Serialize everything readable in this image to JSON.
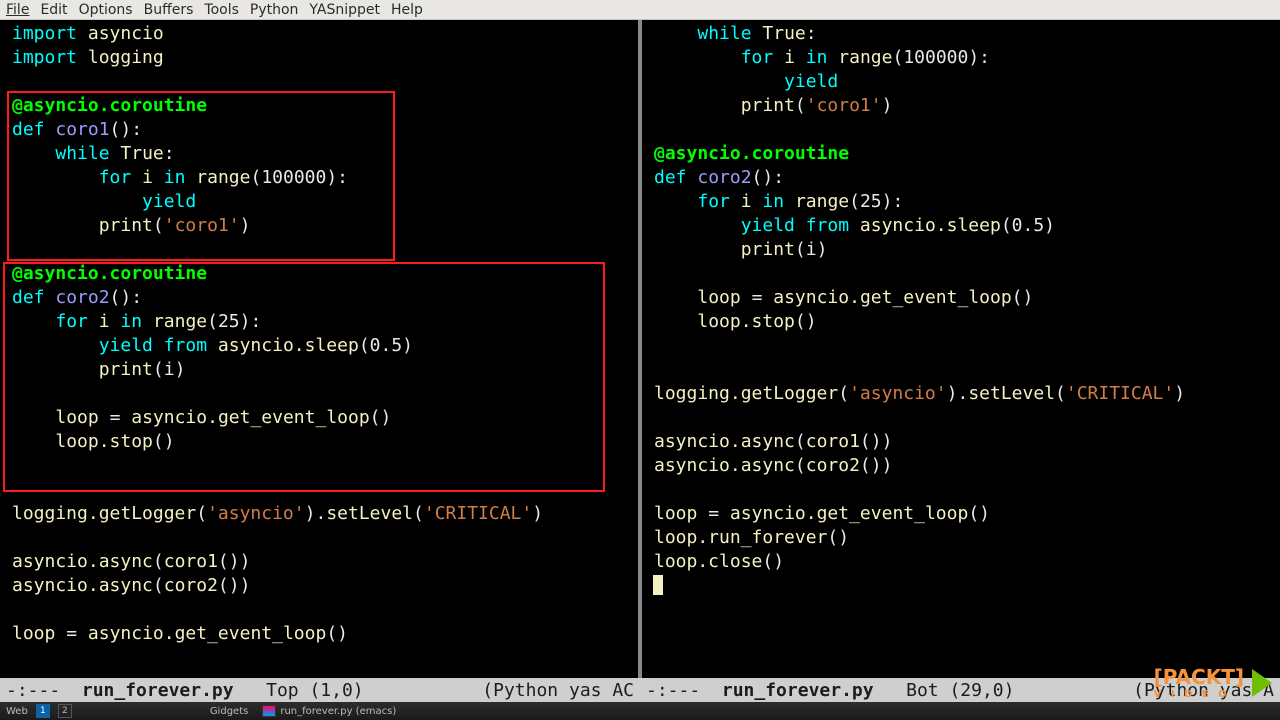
{
  "menubar": [
    "File",
    "Edit",
    "Options",
    "Buffers",
    "Tools",
    "Python",
    "YASnippet",
    "Help"
  ],
  "left": {
    "code_html": "<span class='kw'>import</span> <span class='id'>asyncio</span>\n<span class='kw'>import</span> <span class='id'>logging</span>\n\n<span class='dec'>@asyncio.coroutine</span>\n<span class='kw'>def</span> <span class='fn'>coro1</span><span class='pn'>():</span>\n    <span class='kw'>while</span> <span class='id'>True</span><span class='pn'>:</span>\n        <span class='kw'>for</span> <span class='id'>i</span> <span class='kw'>in</span> <span class='id'>range</span><span class='pn'>(</span><span class='num'>100000</span><span class='pn'>):</span>\n            <span class='kw'>yield</span>\n        <span class='id'>print</span><span class='pn'>(</span><span class='str'>'coro1'</span><span class='pn'>)</span>\n\n<span class='dec'>@asyncio.coroutine</span>\n<span class='kw'>def</span> <span class='fn'>coro2</span><span class='pn'>():</span>\n    <span class='kw'>for</span> <span class='id'>i</span> <span class='kw'>in</span> <span class='id'>range</span><span class='pn'>(</span><span class='num'>25</span><span class='pn'>):</span>\n        <span class='kw'>yield from</span> <span class='id'>asyncio.sleep</span><span class='pn'>(</span><span class='num'>0.5</span><span class='pn'>)</span>\n        <span class='id'>print</span><span class='pn'>(i)</span>\n\n    <span class='id'>loop</span> <span class='pn'>=</span> <span class='id'>asyncio.get_event_loop</span><span class='pn'>()</span>\n    <span class='id'>loop.stop</span><span class='pn'>()</span>\n\n\n<span class='id'>logging.getLogger</span><span class='pn'>(</span><span class='str'>'asyncio'</span><span class='pn'>).</span><span class='id'>setLevel</span><span class='pn'>(</span><span class='str'>'CRITICAL'</span><span class='pn'>)</span>\n\n<span class='id'>asyncio.async</span><span class='pn'>(</span><span class='id'>coro1</span><span class='pn'>())</span>\n<span class='id'>asyncio.async</span><span class='pn'>(</span><span class='id'>coro2</span><span class='pn'>())</span>\n\n<span class='id'>loop</span> <span class='pn'>=</span> <span class='id'>asyncio.get_event_loop</span><span class='pn'>()</span>"
  },
  "right": {
    "code_html": "    <span class='kw'>while</span> <span class='id'>True</span><span class='pn'>:</span>\n        <span class='kw'>for</span> <span class='id'>i</span> <span class='kw'>in</span> <span class='id'>range</span><span class='pn'>(</span><span class='num'>100000</span><span class='pn'>):</span>\n            <span class='kw'>yield</span>\n        <span class='id'>print</span><span class='pn'>(</span><span class='str'>'coro1'</span><span class='pn'>)</span>\n\n<span class='dec'>@asyncio.coroutine</span>\n<span class='kw'>def</span> <span class='fn'>coro2</span><span class='pn'>():</span>\n    <span class='kw'>for</span> <span class='id'>i</span> <span class='kw'>in</span> <span class='id'>range</span><span class='pn'>(</span><span class='num'>25</span><span class='pn'>):</span>\n        <span class='kw'>yield from</span> <span class='id'>asyncio.sleep</span><span class='pn'>(</span><span class='num'>0.5</span><span class='pn'>)</span>\n        <span class='id'>print</span><span class='pn'>(i)</span>\n\n    <span class='id'>loop</span> <span class='pn'>=</span> <span class='id'>asyncio.get_event_loop</span><span class='pn'>()</span>\n    <span class='id'>loop.stop</span><span class='pn'>()</span>\n\n\n<span class='id'>logging.getLogger</span><span class='pn'>(</span><span class='str'>'asyncio'</span><span class='pn'>).</span><span class='id'>setLevel</span><span class='pn'>(</span><span class='str'>'CRITICAL'</span><span class='pn'>)</span>\n\n<span class='id'>asyncio.async</span><span class='pn'>(</span><span class='id'>coro1</span><span class='pn'>())</span>\n<span class='id'>asyncio.async</span><span class='pn'>(</span><span class='id'>coro2</span><span class='pn'>())</span>\n\n<span class='id'>loop</span> <span class='pn'>=</span> <span class='id'>asyncio.get_event_loop</span><span class='pn'>()</span>\n<span class='id'>loop.run_forever</span><span class='pn'>()</span>\n<span class='id'>loop.close</span><span class='pn'>()</span>\n<span class='cursor-block'></span>"
  },
  "modeline": {
    "left": {
      "flags": "-:---",
      "fname": "run_forever.py",
      "pos": "Top (1,0)",
      "modes": "(Python yas AC"
    },
    "right": {
      "flags": "-:---",
      "fname": "run_forever.py",
      "pos": "Bot (29,0)",
      "modes": "(Python yas A"
    }
  },
  "taskbar": {
    "label": "Web",
    "workspaces": [
      "1",
      "2"
    ],
    "gidgets_label": "Gidgets",
    "task": "run_forever.py (emacs)"
  },
  "branding": {
    "word": "PACKT",
    "sub": "V I D E O"
  }
}
